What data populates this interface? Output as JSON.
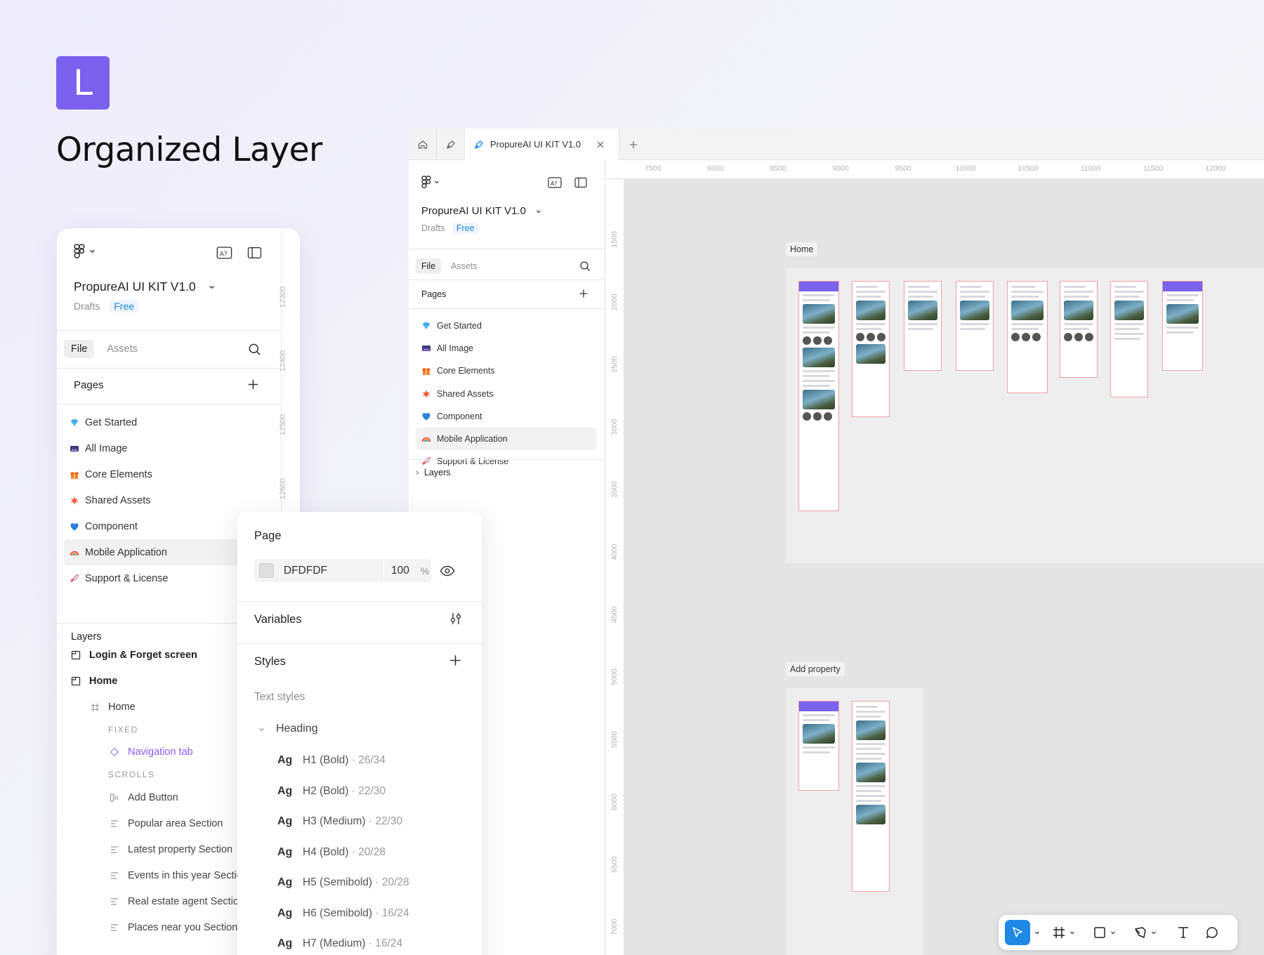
{
  "brand": {
    "logo_letter": "L",
    "headline": "Organized Layer",
    "accent": "#7b61ee"
  },
  "file": {
    "name": "PropureAI UI KIT V1.0",
    "drafts": "Drafts",
    "plan": "Free",
    "tab_file": "File",
    "tab_assets": "Assets"
  },
  "pages_header": "Pages",
  "pages": [
    {
      "icon": "gem-icon",
      "label": "Get Started"
    },
    {
      "icon": "photo-icon",
      "label": "All Image"
    },
    {
      "icon": "gift-icon",
      "label": "Core Elements"
    },
    {
      "icon": "spark-icon",
      "label": "Shared Assets"
    },
    {
      "icon": "heart-icon",
      "label": "Component"
    },
    {
      "icon": "rainbow-icon",
      "label": "Mobile Application"
    },
    {
      "icon": "rocket-icon",
      "label": "Support & License"
    }
  ],
  "layers": {
    "header": "Layers",
    "items": [
      {
        "label": "Login & Forget screen",
        "kind": "section"
      },
      {
        "label": "Home",
        "kind": "section"
      },
      {
        "label": "Home",
        "kind": "frame"
      },
      {
        "label": "FIXED",
        "kind": "group-label"
      },
      {
        "label": "Navigation tab",
        "kind": "component"
      },
      {
        "label": "SCROLLS",
        "kind": "group-label"
      },
      {
        "label": "Add Button",
        "kind": "frame"
      },
      {
        "label": "Popular area Section",
        "kind": "frame"
      },
      {
        "label": "Latest property Section",
        "kind": "frame"
      },
      {
        "label": "Events in this year Section",
        "kind": "frame"
      },
      {
        "label": "Real estate agent Section",
        "kind": "frame"
      },
      {
        "label": "Places near you Section",
        "kind": "frame"
      }
    ]
  },
  "left_ruler": [
    "12300",
    "12400",
    "12500",
    "12600"
  ],
  "page_panel": {
    "title": "Page",
    "bg_hex": "DFDFDF",
    "opacity": "100",
    "opacity_unit": "%",
    "variables": "Variables",
    "styles": "Styles",
    "text_styles": "Text styles",
    "group": "Heading",
    "text_styles_list": [
      {
        "sample": "Ag",
        "name": "H1 (Bold)",
        "meta": " · 26/34"
      },
      {
        "sample": "Ag",
        "name": "H2 (Bold)",
        "meta": " · 22/30"
      },
      {
        "sample": "Ag",
        "name": "H3 (Medium)",
        "meta": " · 22/30"
      },
      {
        "sample": "Ag",
        "name": "H4 (Bold)",
        "meta": " · 20/28"
      },
      {
        "sample": "Ag",
        "name": "H5 (Semibold)",
        "meta": " · 20/28"
      },
      {
        "sample": "Ag",
        "name": "H6 (Semibold)",
        "meta": " · 16/24"
      },
      {
        "sample": "Ag",
        "name": "H7 (Medium)",
        "meta": " · 16/24"
      }
    ]
  },
  "window": {
    "tab_title": "PropureAI UI KIT V1.0",
    "layers_collapsed": "Layers",
    "ruler_h": [
      "7500",
      "8000",
      "8500",
      "9000",
      "9500",
      "10000",
      "10500",
      "11000",
      "11500",
      "12000"
    ],
    "ruler_v": [
      "1500",
      "2000",
      "2500",
      "3000",
      "3500",
      "4000",
      "4500",
      "5000",
      "5500",
      "6000",
      "6500",
      "7000"
    ],
    "sections": [
      "Home",
      "Add property"
    ],
    "selection_color": "#1e88e5"
  }
}
